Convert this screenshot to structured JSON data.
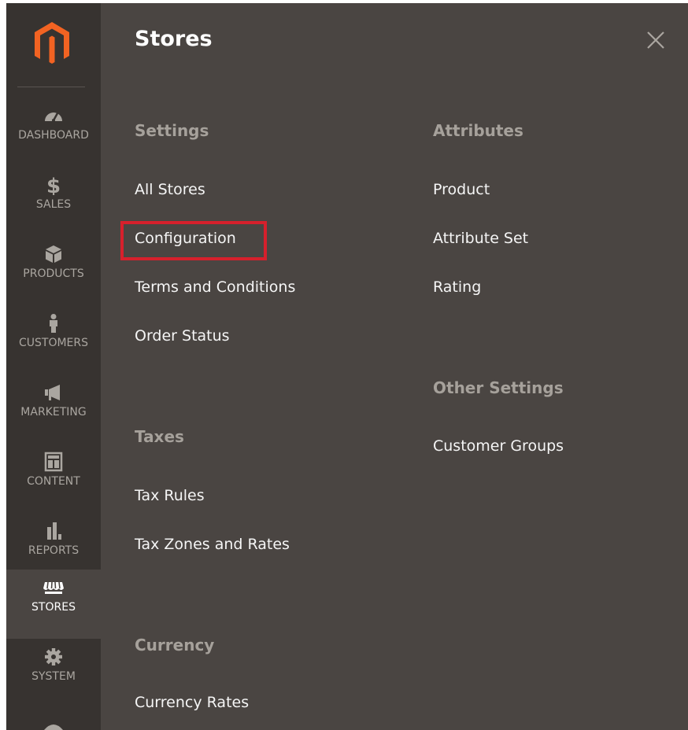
{
  "sidebar": {
    "items": [
      {
        "label": "DASHBOARD",
        "icon": "dashboard-gauge-icon"
      },
      {
        "label": "SALES",
        "icon": "dollar-icon"
      },
      {
        "label": "PRODUCTS",
        "icon": "cube-icon"
      },
      {
        "label": "CUSTOMERS",
        "icon": "person-icon"
      },
      {
        "label": "MARKETING",
        "icon": "megaphone-icon"
      },
      {
        "label": "CONTENT",
        "icon": "layout-icon"
      },
      {
        "label": "REPORTS",
        "icon": "bar-chart-icon"
      },
      {
        "label": "STORES",
        "icon": "storefront-icon",
        "active": true
      },
      {
        "label": "SYSTEM",
        "icon": "gear-icon"
      }
    ]
  },
  "panel": {
    "title": "Stores",
    "settings": {
      "heading": "Settings",
      "links": [
        "All Stores",
        "Configuration",
        "Terms and Conditions",
        "Order Status"
      ]
    },
    "taxes": {
      "heading": "Taxes",
      "links": [
        "Tax Rules",
        "Tax Zones and Rates"
      ]
    },
    "currency": {
      "heading": "Currency",
      "links": [
        "Currency Rates"
      ]
    },
    "attributes": {
      "heading": "Attributes",
      "links": [
        "Product",
        "Attribute Set",
        "Rating"
      ]
    },
    "other_settings": {
      "heading": "Other Settings",
      "links": [
        "Customer Groups"
      ]
    },
    "highlighted_item": "Configuration"
  },
  "colors": {
    "sidebar_bg": "#373330",
    "panel_bg": "#4a4542",
    "logo_orange": "#f26322",
    "highlight_red": "#d6202c"
  }
}
